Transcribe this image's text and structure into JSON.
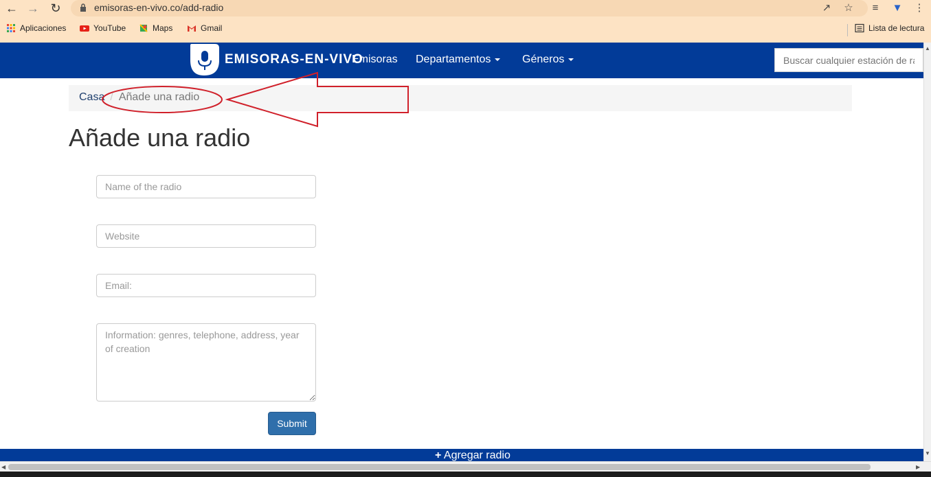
{
  "browser": {
    "url": "emisoras-en-vivo.co/add-radio",
    "bookmarks": [
      "Aplicaciones",
      "YouTube",
      "Maps",
      "Gmail"
    ],
    "reading_list": "Lista de lectura"
  },
  "navbar": {
    "logo_text": "EMISORAS-EN-VIVO",
    "links": [
      "Emisoras",
      "Departamentos",
      "Géneros"
    ],
    "search_placeholder": "Buscar cualquier estación de radio"
  },
  "breadcrumb": {
    "home": "Casa",
    "separator": "/",
    "current": "Añade una radio"
  },
  "page": {
    "title": "Añade una radio",
    "form": {
      "name_placeholder": "Name of the radio",
      "website_placeholder": "Website",
      "email_placeholder": "Email:",
      "info_placeholder": "Information: genres, telephone, address, year of creation",
      "submit_label": "Submit"
    }
  },
  "footer": {
    "add_radio_label": "Agregar radio"
  },
  "colors": {
    "navbar": "#023b98",
    "annotation": "#d0202a",
    "chrome": "#fde3c4"
  }
}
